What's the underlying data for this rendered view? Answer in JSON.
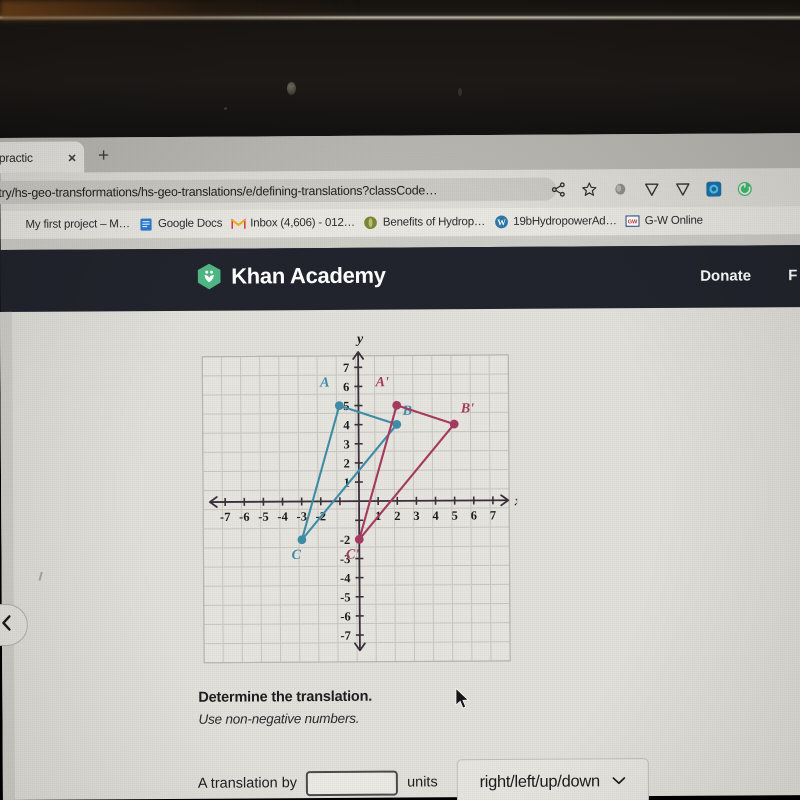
{
  "browser": {
    "tab": {
      "title": "s (practic",
      "close_label": "×",
      "new_tab_label": "+"
    },
    "url": "try/hs-geo-transformations/hs-geo-translations/e/defining-translations?classCode…",
    "omni_icons": [
      "share-icon",
      "star-icon",
      "extension-icon",
      "shield-extension-icon",
      "shield-extension-icon-2",
      "blue-extension-icon",
      "green-extension-icon"
    ],
    "bookmarks": [
      {
        "label": "My first project – M…",
        "icon": "no-favicon"
      },
      {
        "label": "Google Docs",
        "icon": "google-docs-icon"
      },
      {
        "label": "Inbox (4,606) - 012…",
        "icon": "gmail-icon"
      },
      {
        "label": "Benefits of Hydrop…",
        "icon": "olive-circle-icon"
      },
      {
        "label": "19bHydropowerAd…",
        "icon": "wordpress-icon"
      },
      {
        "label": "G-W Online",
        "icon": "gw-icon"
      }
    ]
  },
  "khan_nav": {
    "brand": "Khan Academy",
    "logo": "khan-leaf-icon",
    "donate": "Donate",
    "free_label": "F"
  },
  "page": {
    "prev_button_icon": "chevron-left-icon",
    "prompt_title": "Determine the translation.",
    "prompt_subtitle": "Use non-negative numbers.",
    "answer": {
      "lead_text": "A translation by",
      "input_value": "",
      "input_placeholder": "",
      "units_label": "units",
      "select_value": "right/left/up/down",
      "select_caret": "chevron-down-icon",
      "select_options": [
        "right",
        "left",
        "up",
        "down"
      ]
    }
  },
  "chart_data": {
    "type": "scatter",
    "title": "",
    "xlabel": "x",
    "ylabel": "y",
    "xlim": [
      -7.8,
      7.8
    ],
    "ylim": [
      -7.8,
      7.8
    ],
    "xticks": [
      -7,
      -6,
      -5,
      -4,
      -3,
      -2,
      -1,
      1,
      2,
      3,
      4,
      5,
      6,
      7
    ],
    "xtick_labels": [
      "-7",
      "-6",
      "-5",
      "-4",
      "-3",
      "-2",
      "",
      "1",
      "2",
      "3",
      "4",
      "5",
      "6",
      "7"
    ],
    "yticks": [
      -7,
      -6,
      -5,
      -4,
      -3,
      -2,
      -1,
      1,
      2,
      3,
      4,
      5,
      6,
      7
    ],
    "ytick_labels": [
      "-7",
      "-6",
      "-5",
      "-4",
      "-3",
      "-2",
      "",
      "1",
      "2",
      "3",
      "4",
      "5",
      "6",
      "7"
    ],
    "grid": true,
    "legend": "none",
    "colors": {
      "preimage": "#3f8ea8",
      "image": "#a63a60",
      "grid": "#c9c7c1",
      "axis": "#3a2f3a"
    },
    "series": [
      {
        "name": "preimage-triangle-ABC",
        "color": "#3f8ea8",
        "points": [
          {
            "label": "A",
            "x": -1,
            "y": 5
          },
          {
            "label": "B",
            "x": 2,
            "y": 4
          },
          {
            "label": "C",
            "x": -3,
            "y": -2
          }
        ],
        "label_positions": [
          {
            "label": "A",
            "x": -1.75,
            "y": 6.0
          },
          {
            "label": "B",
            "x": 2.55,
            "y": 4.5
          },
          {
            "label": "C",
            "x": -3.3,
            "y": -3.0
          }
        ]
      },
      {
        "name": "image-triangle-A-prime-B-prime-C-prime",
        "color": "#a63a60",
        "points": [
          {
            "label": "A'",
            "x": 2,
            "y": 5
          },
          {
            "label": "B'",
            "x": 5,
            "y": 4
          },
          {
            "label": "C'",
            "x": 0,
            "y": -2
          }
        ],
        "label_positions": [
          {
            "label": "A'",
            "x": 1.25,
            "y": 6.0
          },
          {
            "label": "B'",
            "x": 5.7,
            "y": 4.6
          },
          {
            "label": "C'",
            "x": -0.35,
            "y": -3.0
          }
        ]
      }
    ],
    "translation": {
      "dx": 3,
      "dy": 0,
      "description": "3 units right"
    }
  }
}
